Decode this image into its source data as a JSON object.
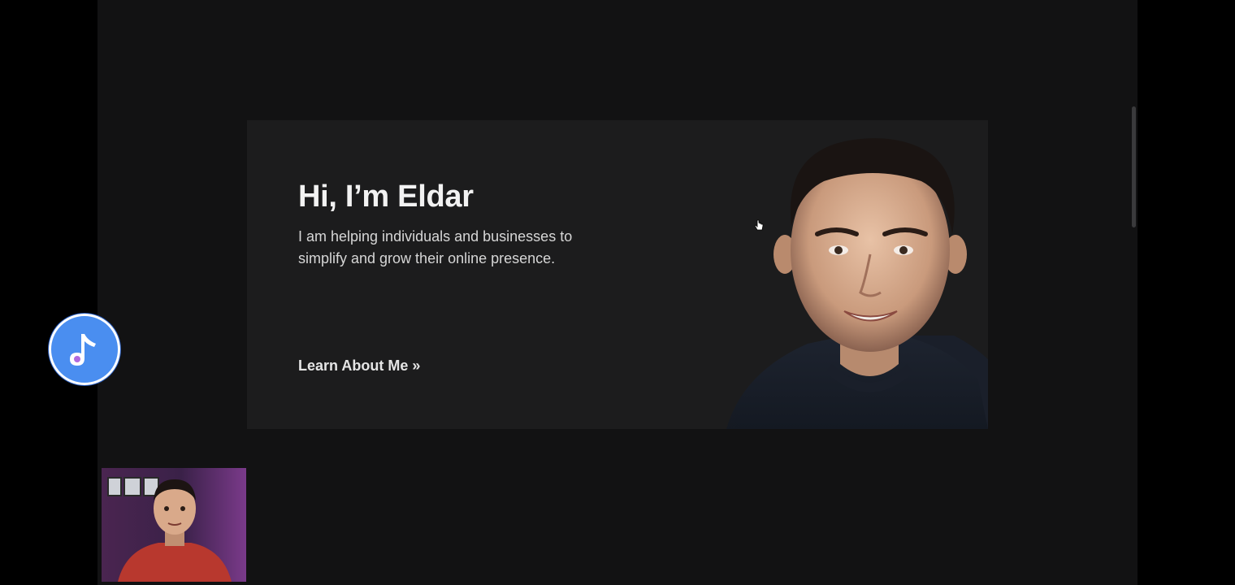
{
  "hero": {
    "title": "Hi, I’m Eldar",
    "description": "I am helping individuals and businesses to simplify and grow their online presence.",
    "cta_label": "Learn About Me »"
  },
  "icons": {
    "music_button": "music-note-icon",
    "cursor": "hand-cursor-icon",
    "portrait": "person-portrait-image",
    "webcam": "webcam-overlay-image"
  },
  "colors": {
    "page_background": "#121213",
    "card_background": "#1c1c1d",
    "heading_text": "#f2f2f2",
    "body_text": "#d6d6d6",
    "fab_blue": "#4a8ef0"
  }
}
